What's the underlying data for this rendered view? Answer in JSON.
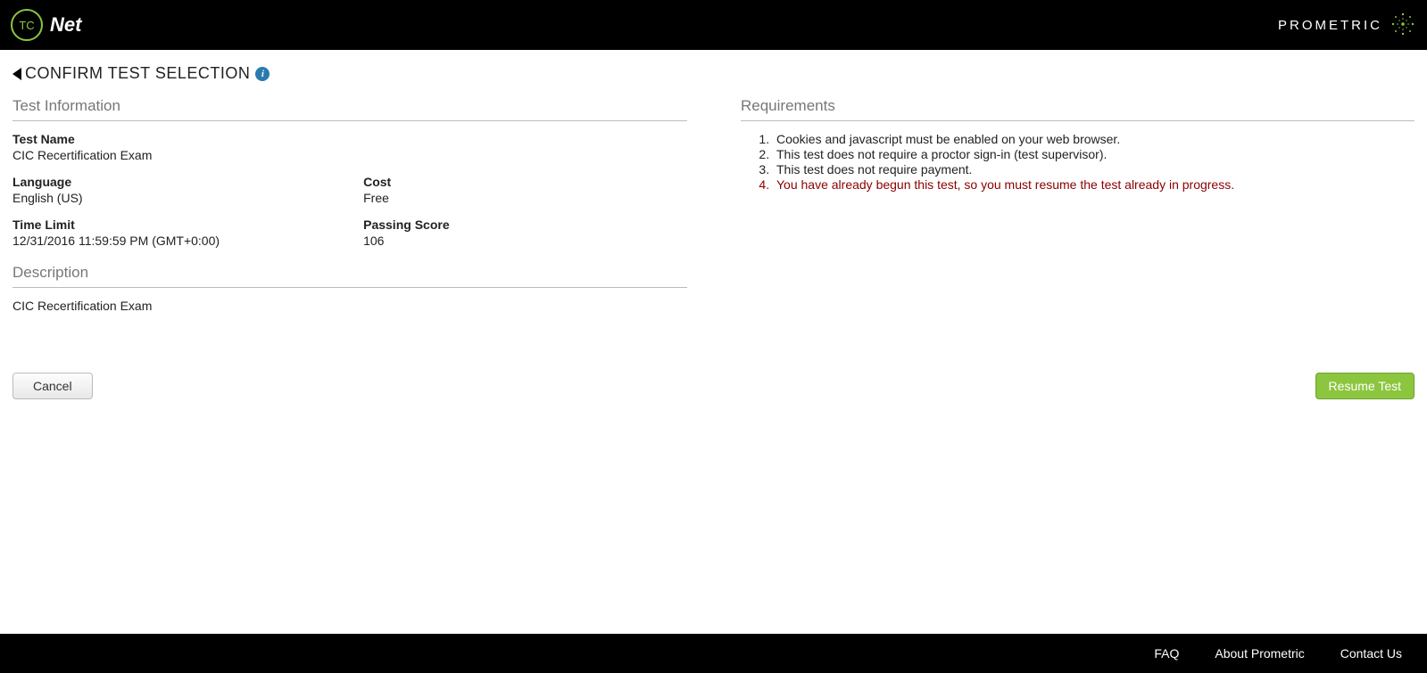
{
  "header": {
    "logo_tc": "TC",
    "logo_net": "Net",
    "prometric": "PROMETRIC"
  },
  "page": {
    "title": "CONFIRM TEST SELECTION"
  },
  "test_info": {
    "heading": "Test Information",
    "fields": {
      "test_name_label": "Test Name",
      "test_name_value": "CIC Recertification Exam",
      "language_label": "Language",
      "language_value": "English (US)",
      "cost_label": "Cost",
      "cost_value": "Free",
      "time_limit_label": "Time Limit",
      "time_limit_value": "12/31/2016 11:59:59 PM (GMT+0:00)",
      "passing_score_label": "Passing Score",
      "passing_score_value": "106"
    }
  },
  "description": {
    "heading": "Description",
    "text": "CIC Recertification Exam"
  },
  "requirements": {
    "heading": "Requirements",
    "items": [
      {
        "text": "Cookies and javascript must be enabled on your web browser.",
        "warning": false
      },
      {
        "text": "This test does not require a proctor sign-in (test supervisor).",
        "warning": false
      },
      {
        "text": "This test does not require payment.",
        "warning": false
      },
      {
        "text": "You have already begun this test, so you must resume the test already in progress.",
        "warning": true
      }
    ]
  },
  "buttons": {
    "cancel": "Cancel",
    "resume": "Resume Test"
  },
  "footer": {
    "faq": "FAQ",
    "about": "About Prometric",
    "contact": "Contact Us"
  }
}
